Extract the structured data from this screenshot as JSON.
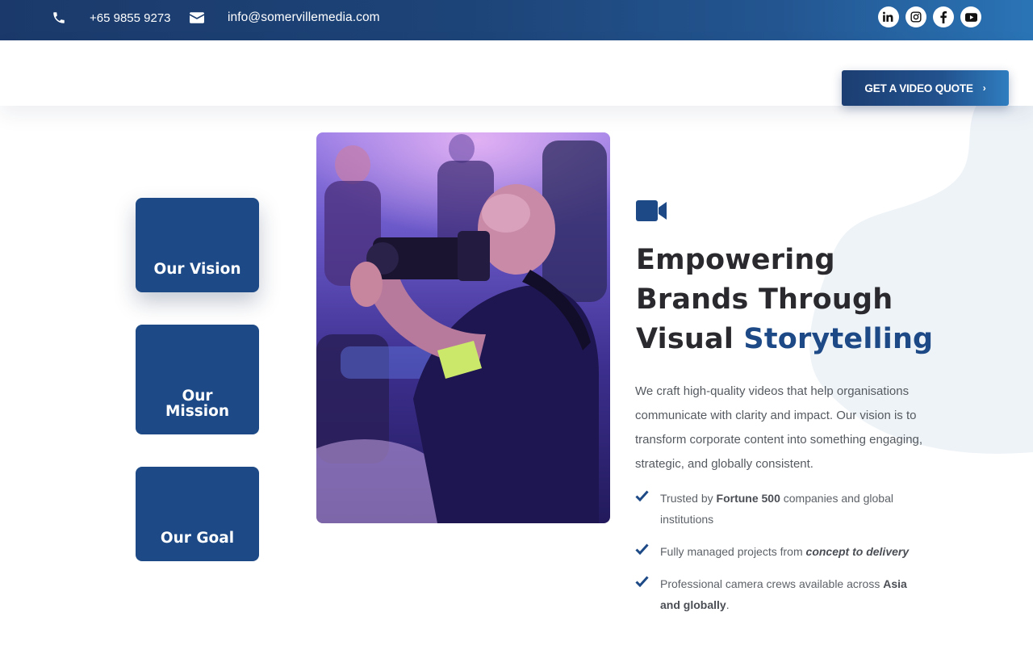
{
  "topbar": {
    "phone": "+65 9855 9273",
    "email": "info@somervillemedia.com",
    "phone_icon": "phone-icon",
    "email_icon": "envelope-icon",
    "social": [
      {
        "name": "linkedin-icon",
        "glyph": "in"
      },
      {
        "name": "instagram-icon",
        "glyph": ""
      },
      {
        "name": "facebook-icon",
        "glyph": "f"
      },
      {
        "name": "youtube-icon",
        "glyph": ""
      }
    ]
  },
  "header": {
    "quote_button": "GET A VIDEO QUOTE",
    "quote_chevron": "›"
  },
  "cards": {
    "vision": "Our Vision",
    "mission": "Our Mission",
    "goal": "Our Goal"
  },
  "content": {
    "headline_line1": "Empowering",
    "headline_line2": "Brands Through",
    "headline_line3_plain": "Visual ",
    "headline_line3_accent": "Storytelling",
    "description": "We craft high-quality videos that help organisations communicate with clarity and impact. Our vision is to transform corporate content into something engaging, strategic, and globally consistent.",
    "features": [
      {
        "pre": "Trusted by ",
        "bold": "Fortune 500",
        "post": " companies and global institutions"
      },
      {
        "pre": "Fully managed projects from ",
        "bold_italic": "concept to delivery",
        "post": ""
      },
      {
        "pre": "Professional camera crews available across ",
        "bold": "Asia and globally",
        "post": "."
      }
    ]
  },
  "colors": {
    "brand_blue": "#1d4a86",
    "topbar_start": "#1b3a6b",
    "topbar_end": "#2a74b6",
    "headline_dark": "#2a2a2e",
    "body_text": "#555a60"
  }
}
